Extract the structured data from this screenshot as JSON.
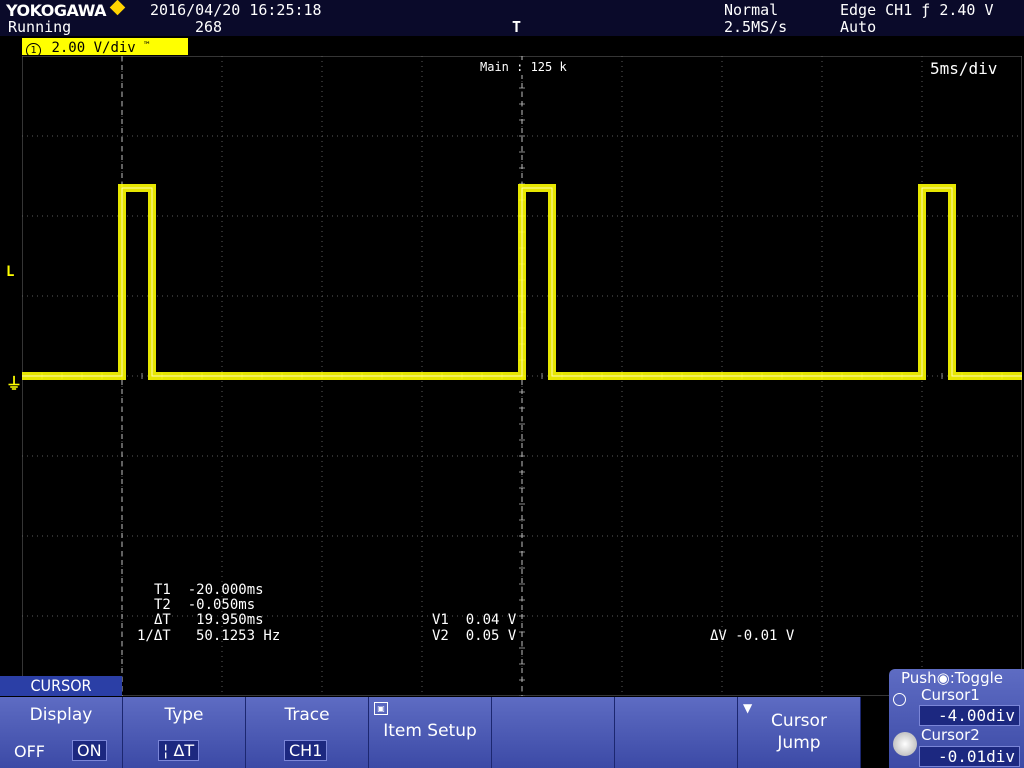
{
  "header": {
    "brand": "YOKOGAWA",
    "datetime": "2016/04/20 16:25:18",
    "status": "Running",
    "acq_count": "268",
    "acq_mode": "Normal",
    "sample_rate": "2.5MS/s",
    "trigger": "Edge CH1 ƒ 2.40 V",
    "trigger_mode": "Auto",
    "trigger_pos_marker": "T"
  },
  "channel_bar": {
    "channel": "1",
    "scale": "2.00 V/div",
    "suffix": "™"
  },
  "screen": {
    "zoom_info": "Main : 125 k",
    "timebase": "5ms/div",
    "trigger_level_marker": "L",
    "ground_marker": "⏚",
    "waveform_color": "#ffff00",
    "waveform": {
      "type": "pulse_train",
      "period_ms": 20,
      "pulse_width_ms": 1.5,
      "high_level_v": 4.7,
      "low_level_v": 0.0,
      "pulse_starts_ms": [
        -20,
        0,
        20
      ]
    }
  },
  "measurements": {
    "t1": "T1  -20.000ms",
    "t2": "T2  -0.050ms",
    "dt": "ΔT   19.950ms",
    "inv_dt": "1/ΔT   50.1253 Hz",
    "v1": "V1  0.04 V",
    "v2": "V2  0.05 V",
    "dv": "ΔV -0.01 V"
  },
  "menu": {
    "tab": "CURSOR",
    "display": {
      "title": "Display",
      "off": "OFF",
      "on": "ON"
    },
    "type": {
      "title": "Type",
      "value": "¦ ΔT"
    },
    "trace": {
      "title": "Trace",
      "value": "CH1"
    },
    "item_setup": {
      "title": "Item Setup"
    },
    "cursor_jump": {
      "title": "Cursor",
      "title2": "Jump"
    },
    "right": {
      "push_toggle": "Push◉:Toggle",
      "cursor1_label": "Cursor1",
      "cursor1_value": "-4.00div",
      "cursor2_label": "Cursor2",
      "cursor2_value": "-0.01div"
    }
  }
}
